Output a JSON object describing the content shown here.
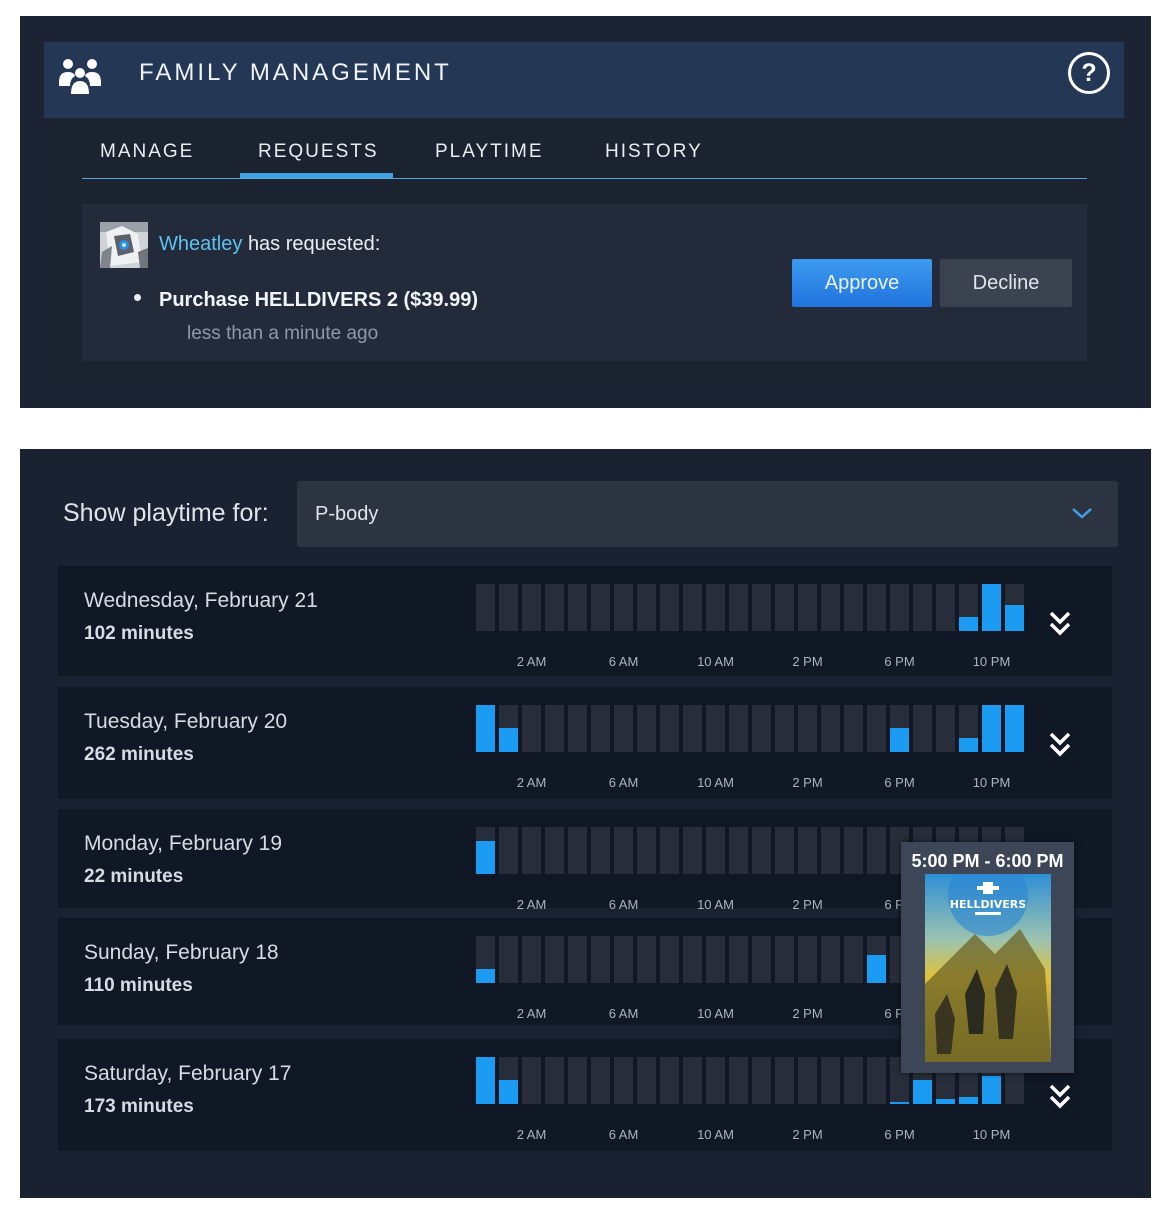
{
  "family_management": {
    "title": "FAMILY MANAGEMENT",
    "tabs": [
      {
        "label": "MANAGE"
      },
      {
        "label": "REQUESTS",
        "active": true
      },
      {
        "label": "PLAYTIME"
      },
      {
        "label": "HISTORY"
      }
    ],
    "request": {
      "user": "Wheatley",
      "text": "has requested:",
      "item": "Purchase HELLDIVERS 2 ($39.99)",
      "time": "less than a minute ago",
      "approve_label": "Approve",
      "decline_label": "Decline"
    }
  },
  "playtime": {
    "show_label": "Show playtime for:",
    "selected": "P-body",
    "tick_labels": [
      "2 AM",
      "6 AM",
      "10 AM",
      "2 PM",
      "6 PM",
      "10 PM"
    ],
    "days": [
      {
        "date": "Wednesday, February 21",
        "total": "102 minutes",
        "hours": [
          0,
          0,
          0,
          0,
          0,
          0,
          0,
          0,
          0,
          0,
          0,
          0,
          0,
          0,
          0,
          0,
          0,
          0,
          0,
          0,
          0,
          0.3,
          1,
          0.55
        ]
      },
      {
        "date": "Tuesday, February 20",
        "total": "262 minutes",
        "hours": [
          1,
          0.5,
          0,
          0,
          0,
          0,
          0,
          0,
          0,
          0,
          0,
          0,
          0,
          0,
          0,
          0,
          0,
          0,
          0.5,
          0,
          0,
          0.3,
          1,
          1
        ]
      },
      {
        "date": "Monday, February 19",
        "total": "22 minutes",
        "hours": [
          0.7,
          0,
          0,
          0,
          0,
          0,
          0,
          0,
          0,
          0,
          0,
          0,
          0,
          0,
          0,
          0,
          0,
          0,
          0,
          0,
          0,
          0,
          0,
          0
        ]
      },
      {
        "date": "Sunday, February 18",
        "total": "110 minutes",
        "hours": [
          0.3,
          0,
          0,
          0,
          0,
          0,
          0,
          0,
          0,
          0,
          0,
          0,
          0,
          0,
          0,
          0,
          0,
          0.6,
          0,
          0,
          0,
          0,
          0,
          0
        ]
      },
      {
        "date": "Saturday, February 17",
        "total": "173 minutes",
        "hours": [
          1,
          0.5,
          0,
          0,
          0,
          0,
          0,
          0,
          0,
          0,
          0,
          0,
          0,
          0,
          0,
          0,
          0,
          0,
          0.05,
          0.5,
          0.1,
          0.15,
          0.6,
          0
        ]
      }
    ],
    "tooltip": {
      "time_range": "5:00 PM - 6:00 PM",
      "game_logo": "HELLDIVERS"
    }
  },
  "colors": {
    "accent": "#1b9cf2",
    "link": "#5ec1f0",
    "header_bg": "#243755",
    "panel_bg": "#1c2434"
  },
  "icons": {
    "family": "family-group-icon",
    "help": "question-mark-icon",
    "dropdown": "chevron-down-icon",
    "expand": "double-chevron-down-icon"
  }
}
